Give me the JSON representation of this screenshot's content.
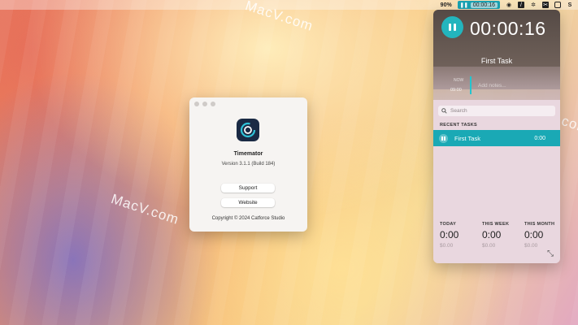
{
  "menubar": {
    "battery": "90%",
    "timer": "00:00:16",
    "icons": [
      "pause-icon",
      "eye-icon",
      "slash-icon",
      "atom-icon",
      "scissors-icon",
      "shield-icon",
      "s-icon"
    ]
  },
  "watermarks": [
    "MacV.com",
    "MacV.com",
    "MacV.com"
  ],
  "about": {
    "title": "Timemator",
    "version": "Version 3.1.1 (Build 184)",
    "support_label": "Support",
    "website_label": "Website",
    "copyright": "Copyright © 2024 Catforce Studio"
  },
  "panel": {
    "timer": "00:00:16",
    "task_title": "First Task",
    "now_label": "NOW",
    "now_time": "09:00",
    "notes_placeholder": "Add notes...",
    "search_placeholder": "Search",
    "recent_label": "RECENT TASKS",
    "recent": [
      {
        "name": "First Task",
        "time": "0:00"
      }
    ],
    "stats": [
      {
        "label": "TODAY",
        "value": "0:00",
        "money": "$0.00"
      },
      {
        "label": "THIS WEEK",
        "value": "0:00",
        "money": "$0.00"
      },
      {
        "label": "THIS MONTH",
        "value": "0:00",
        "money": "$0.00"
      }
    ]
  },
  "colors": {
    "accent": "#1aa9b5",
    "panel_dark": "#554a45",
    "panel_light": "#e9d7df"
  }
}
